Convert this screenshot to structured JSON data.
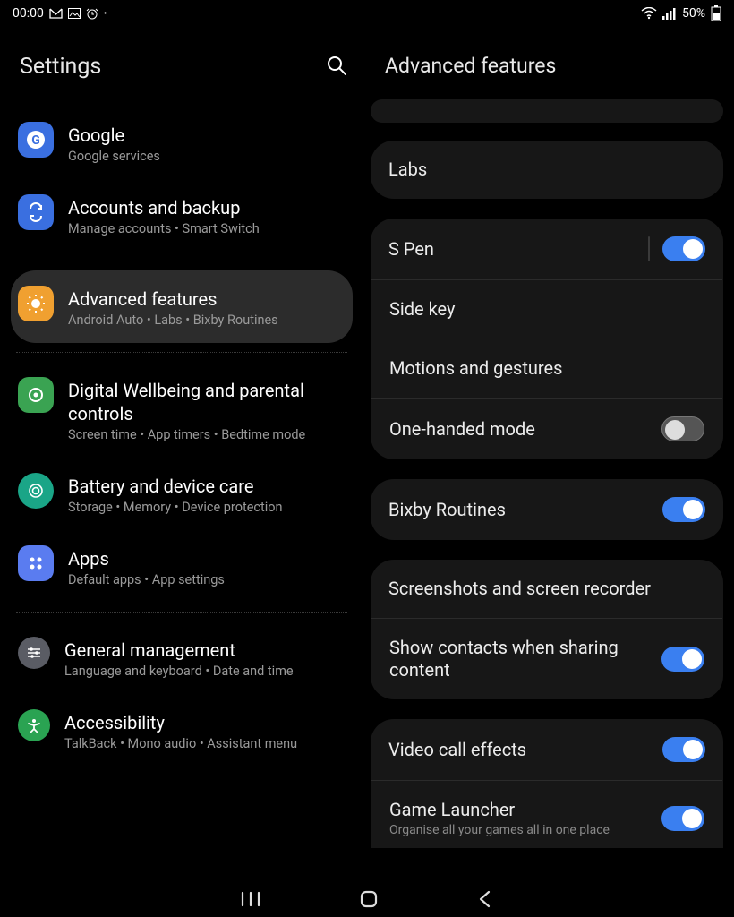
{
  "status": {
    "time": "00:00",
    "battery": "50%"
  },
  "left": {
    "header_title": "Settings",
    "items": [
      {
        "title": "Google",
        "sub": "Google services",
        "icon_bg": "#3a6fe0",
        "icon": "g-icon"
      },
      {
        "title": "Accounts and backup",
        "sub": "Manage accounts  •  Smart Switch",
        "icon_bg": "#3a6fe0",
        "icon": "sync-icon"
      },
      {
        "title": "Advanced features",
        "sub": "Android Auto  •  Labs  •  Bixby Routines",
        "icon_bg": "#f0a030",
        "icon": "gear-badge-icon",
        "selected": true
      },
      {
        "title": "Digital Wellbeing and parental controls",
        "sub": "Screen time  •  App timers  •  Bedtime mode",
        "icon_bg": "#3aa352",
        "icon": "wellbeing-icon"
      },
      {
        "title": "Battery and device care",
        "sub": "Storage  •  Memory  •  Device protection",
        "icon_bg": "#1aa587",
        "icon": "care-icon"
      },
      {
        "title": "Apps",
        "sub": "Default apps  •  App settings",
        "icon_bg": "#5a7cf0",
        "icon": "apps-icon"
      },
      {
        "title": "General management",
        "sub": "Language and keyboard  •  Date and time",
        "icon_bg": "#5a5c64",
        "icon": "sliders-icon"
      },
      {
        "title": "Accessibility",
        "sub": "TalkBack  •  Mono audio  •  Assistant menu",
        "icon_bg": "#2aa352",
        "icon": "accessibility-icon"
      }
    ]
  },
  "right": {
    "header_title": "Advanced features",
    "groups": [
      {
        "rows": [
          {
            "label": "Labs"
          }
        ]
      },
      {
        "rows": [
          {
            "label": "S Pen",
            "toggle": true,
            "divider": true
          },
          {
            "label": "Side key"
          },
          {
            "label": "Motions and gestures"
          },
          {
            "label": "One-handed mode",
            "toggle": false
          }
        ]
      },
      {
        "rows": [
          {
            "label": "Bixby Routines",
            "toggle": true
          }
        ]
      },
      {
        "rows": [
          {
            "label": "Screenshots and screen recorder"
          },
          {
            "label": "Show contacts when sharing content",
            "toggle": true
          }
        ]
      },
      {
        "rows": [
          {
            "label": "Video call effects",
            "toggle": true
          },
          {
            "label": "Game Launcher",
            "sub": "Organise all your games all in one place",
            "toggle": true
          }
        ]
      }
    ]
  }
}
